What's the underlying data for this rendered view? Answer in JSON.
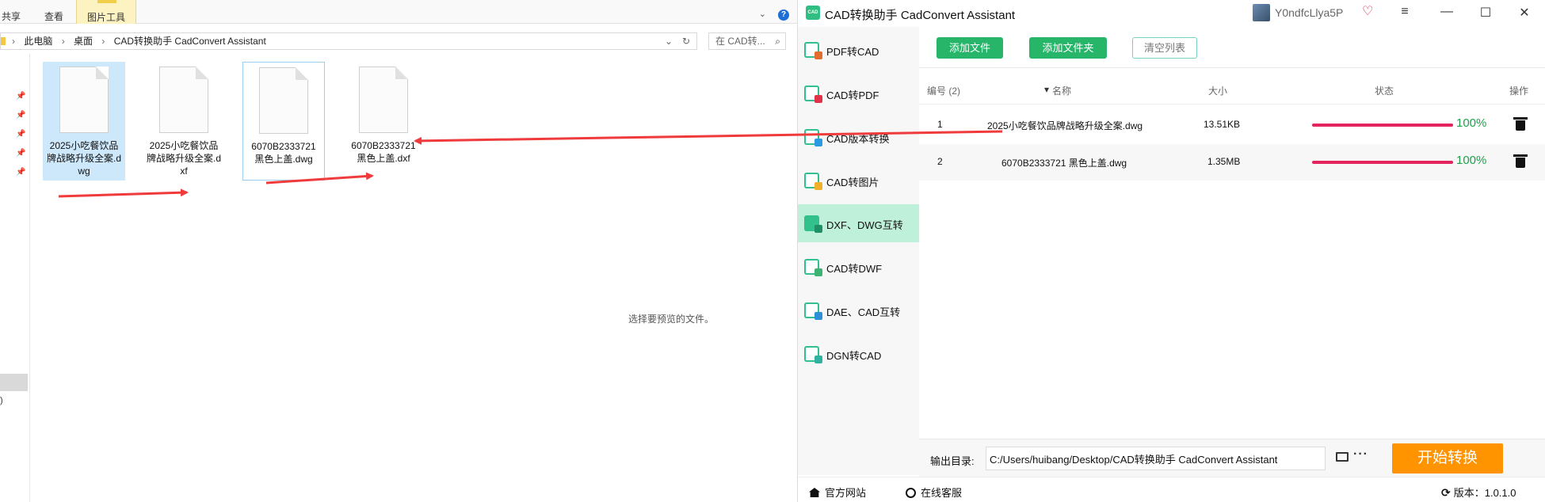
{
  "explorer": {
    "ribbon": {
      "tabs": [
        "共享",
        "查看",
        "图片工具"
      ],
      "collapse_glyph": "⌄"
    },
    "address": {
      "crumb_arrow": "›",
      "path": [
        "此电脑",
        "桌面",
        "CAD转换助手 CadConvert Assistant"
      ],
      "dropdown_glyph": "⌄",
      "refresh_glyph": "↻"
    },
    "search": {
      "placeholder": "在 CAD转...",
      "icon_glyph": "⌕"
    },
    "nav": {
      "pin_glyph": "📌",
      "fragment_text": ")"
    },
    "files": [
      {
        "name": "2025小吃餐饮品牌战略升级全案.dwg",
        "state": "selected"
      },
      {
        "name": "2025小吃餐饮品牌战略升级全案.dxf",
        "state": "normal"
      },
      {
        "name": "6070B2333721 黑色上盖.dwg",
        "state": "focused"
      },
      {
        "name": "6070B2333721 黑色上盖.dxf",
        "state": "normal"
      }
    ],
    "preview_message": "选择要预览的文件。"
  },
  "app": {
    "logo_text": "CAD",
    "title": "CAD转换助手 CadConvert Assistant",
    "user": {
      "name": "Y0ndfcLlya5P",
      "vip_glyph": "♡"
    },
    "window_controls": {
      "menu": "≡",
      "minimize": "—",
      "maximize": "☐",
      "close": "✕"
    },
    "sidebar": [
      {
        "label": "PDF转CAD",
        "accent": "#e46c2f"
      },
      {
        "label": "CAD转PDF",
        "accent": "#e0334a"
      },
      {
        "label": "CAD版本转换",
        "accent": "#2c9ae0"
      },
      {
        "label": "CAD转图片",
        "accent": "#f0b12a"
      },
      {
        "label": "DXF、DWG互转",
        "accent": "#1e8f67",
        "active": true
      },
      {
        "label": "CAD转DWF",
        "accent": "#3cb371"
      },
      {
        "label": "DAE、CAD互转",
        "accent": "#2d8fd5"
      },
      {
        "label": "DGN转CAD",
        "accent": "#2fb3a0"
      }
    ],
    "toolbar": {
      "add_file": "添加文件",
      "add_folder": "添加文件夹",
      "clear_list": "清空列表"
    },
    "table": {
      "headers": {
        "index": "编号 (2)",
        "sort_glyph": "▾",
        "name": "名称",
        "size": "大小",
        "status": "状态",
        "action": "操作"
      },
      "rows": [
        {
          "index": "1",
          "name": "2025小吃餐饮品牌战略升级全案.dwg",
          "size": "13.51KB",
          "progress": 100,
          "percent": "100%"
        },
        {
          "index": "2",
          "name": "6070B2333721 黑色上盖.dwg",
          "size": "1.35MB",
          "progress": 100,
          "percent": "100%"
        }
      ]
    },
    "output": {
      "label": "输出目录:",
      "path": "C:/Users/huibang/Desktop/CAD转换助手 CadConvert Assistant",
      "more_glyph": "···",
      "start": "开始转换"
    },
    "status_bar": {
      "website": "官方网站",
      "support": "在线客服",
      "sync_glyph": "⟳",
      "version": "版本：1.0.1.0"
    },
    "colors": {
      "primary_green": "#27b56a",
      "active_side": "#bff0da",
      "progress": "#e3245f",
      "percent_text": "#1e9f4a",
      "start_button": "#ff9300",
      "annotation_arrow": "#ef3b3b"
    }
  }
}
